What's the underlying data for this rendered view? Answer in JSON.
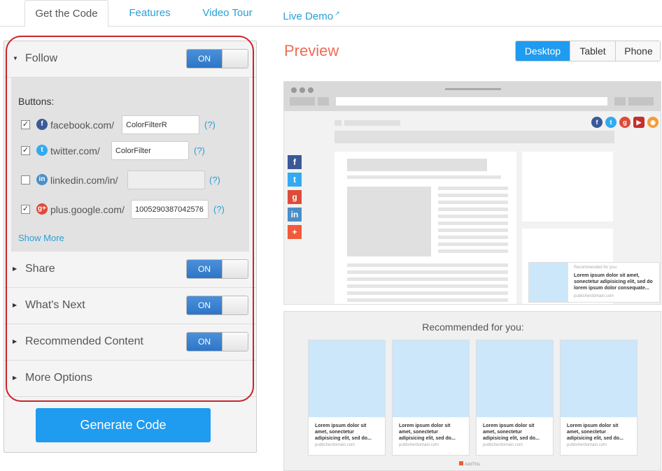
{
  "tabs": [
    {
      "label": "Get the Code"
    },
    {
      "label": "Features"
    },
    {
      "label": "Video Tour"
    },
    {
      "label": "Live Demo",
      "suffix": "↗"
    }
  ],
  "panel": {
    "sections": [
      {
        "label": "Follow",
        "toggle": "ON"
      },
      {
        "label": "Share",
        "toggle": "ON"
      },
      {
        "label": "What's Next",
        "toggle": "ON"
      },
      {
        "label": "Recommended Content",
        "toggle": "ON"
      },
      {
        "label": "More Options"
      }
    ],
    "buttons_label": "Buttons:",
    "services": [
      {
        "name": "facebook.com/",
        "value": "ColorFilterR",
        "checked": true,
        "help": "(?)",
        "icon": "facebook-icon",
        "color": "#3b5998"
      },
      {
        "name": "twitter.com/",
        "value": "ColorFilter",
        "checked": true,
        "help": "(?)",
        "icon": "twitter-icon",
        "color": "#33aaf0"
      },
      {
        "name": "linkedin.com/in/",
        "value": "",
        "checked": false,
        "help": "(?)",
        "icon": "linkedin-icon",
        "color": "#4b8ec6"
      },
      {
        "name": "plus.google.com/",
        "value": "1005290387042576",
        "checked": true,
        "help": "(?)",
        "icon": "googleplus-icon",
        "color": "#dd4b39"
      }
    ],
    "show_more": "Show More",
    "generate": "Generate Code"
  },
  "preview": {
    "title": "Preview",
    "devices": [
      "Desktop",
      "Tablet",
      "Phone"
    ],
    "selected_device": "Desktop",
    "recommended_title": "Recommended for you:",
    "mini_rec": {
      "heading": "Recommended for you:",
      "text": "Lorem ipsum dolor sit amet, sonectetur adipisicing elit, sed do lorem ipsum dolor consequate...",
      "domain": "publisherdomain.com"
    },
    "cards": [
      {
        "text": "Lorem ipsum dolor sit amet, sonectetur adipisicing elit, sed do...",
        "domain": "publisherdomain.com"
      },
      {
        "text": "Lorem ipsum dolor sit amet, sonectetur adipisicing elit, sed do...",
        "domain": "publisherdomain.com"
      },
      {
        "text": "Lorem ipsum dolor sit amet, sonectetur adipisicing elit, sed do...",
        "domain": "publisherdomain.com"
      },
      {
        "text": "Lorem ipsum dolor sit amet, sonectetur adipisicing elit, sed do...",
        "domain": "publisherdomain.com"
      }
    ],
    "addthis": "AddThis"
  },
  "colors": {
    "accent": "#1f9bf0",
    "preview_title": "#ef6b55",
    "outline": "#c8242c"
  }
}
